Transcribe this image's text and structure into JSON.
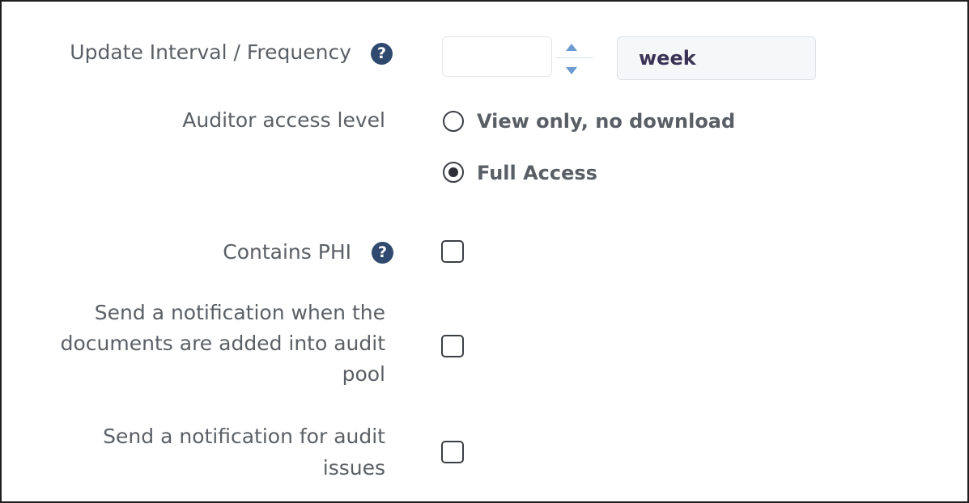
{
  "form": {
    "update_interval": {
      "label": "Update Interval / Frequency",
      "help": "?",
      "number_value": "",
      "unit_value": "week"
    },
    "auditor_access": {
      "label": "Auditor access level",
      "options": [
        {
          "label": "View only, no download",
          "selected": false
        },
        {
          "label": "Full Access",
          "selected": true
        }
      ]
    },
    "contains_phi": {
      "label": "Contains PHI",
      "help": "?",
      "checked": false
    },
    "notify_documents_added": {
      "label_lines": [
        "Send a notification when the",
        "documents are added into audit",
        "pool"
      ],
      "checked": false
    },
    "notify_audit_issues": {
      "label_lines": [
        "Send a notification for audit",
        "issues"
      ],
      "checked": false
    }
  }
}
